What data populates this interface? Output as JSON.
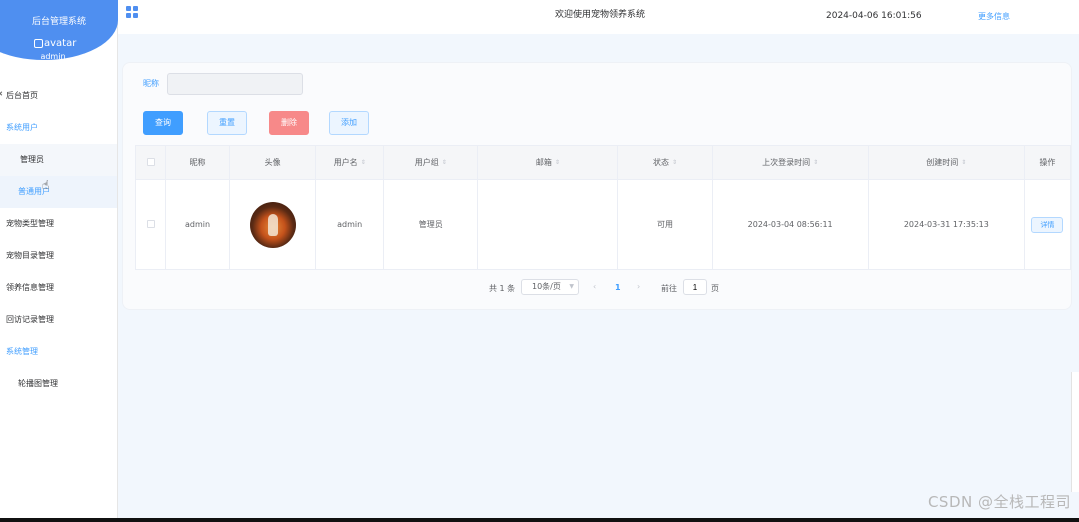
{
  "sidebar": {
    "title": "后台管理系统",
    "avatar_alt": "avatar",
    "username": "admin",
    "menu": [
      {
        "label": "后台首页",
        "type": "item"
      },
      {
        "label": "系统用户",
        "type": "group"
      },
      {
        "label": "管理员",
        "type": "sub"
      },
      {
        "label": "普通用户",
        "type": "sub-active"
      },
      {
        "label": "宠物类型管理",
        "type": "item"
      },
      {
        "label": "宠物目录管理",
        "type": "item"
      },
      {
        "label": "领养信息管理",
        "type": "item"
      },
      {
        "label": "回访记录管理",
        "type": "item"
      },
      {
        "label": "系统管理",
        "type": "group"
      },
      {
        "label": "轮播图管理",
        "type": "sub-plain"
      }
    ]
  },
  "header": {
    "welcome": "欢迎使用宠物领养系统",
    "datetime": "2024-04-06 16:01:56",
    "more": "更多信息"
  },
  "search": {
    "label": "昵称",
    "value": ""
  },
  "toolbar": {
    "query": "查询",
    "reset": "重置",
    "delete": "删除",
    "add": "添加"
  },
  "table": {
    "columns": [
      "",
      "昵称",
      "头像",
      "用户名",
      "用户组",
      "邮箱",
      "状态",
      "上次登录时间",
      "创建时间",
      "操作"
    ],
    "rows": [
      {
        "nickname": "admin",
        "username": "admin",
        "group": "管理员",
        "email": "",
        "status": "可用",
        "last_login": "2024-03-04 08:56:11",
        "created": "2024-03-31 17:35:13",
        "action": "详情"
      }
    ]
  },
  "pagination": {
    "total": "共 1 条",
    "page_size": "10条/页",
    "current": "1",
    "goto": "前往",
    "goto_value": "1",
    "unit": "页"
  },
  "watermark": "CSDN @全栈工程司",
  "colors": {
    "primary": "#409eff",
    "danger": "#f78989",
    "brand": "#4f8ff0"
  }
}
